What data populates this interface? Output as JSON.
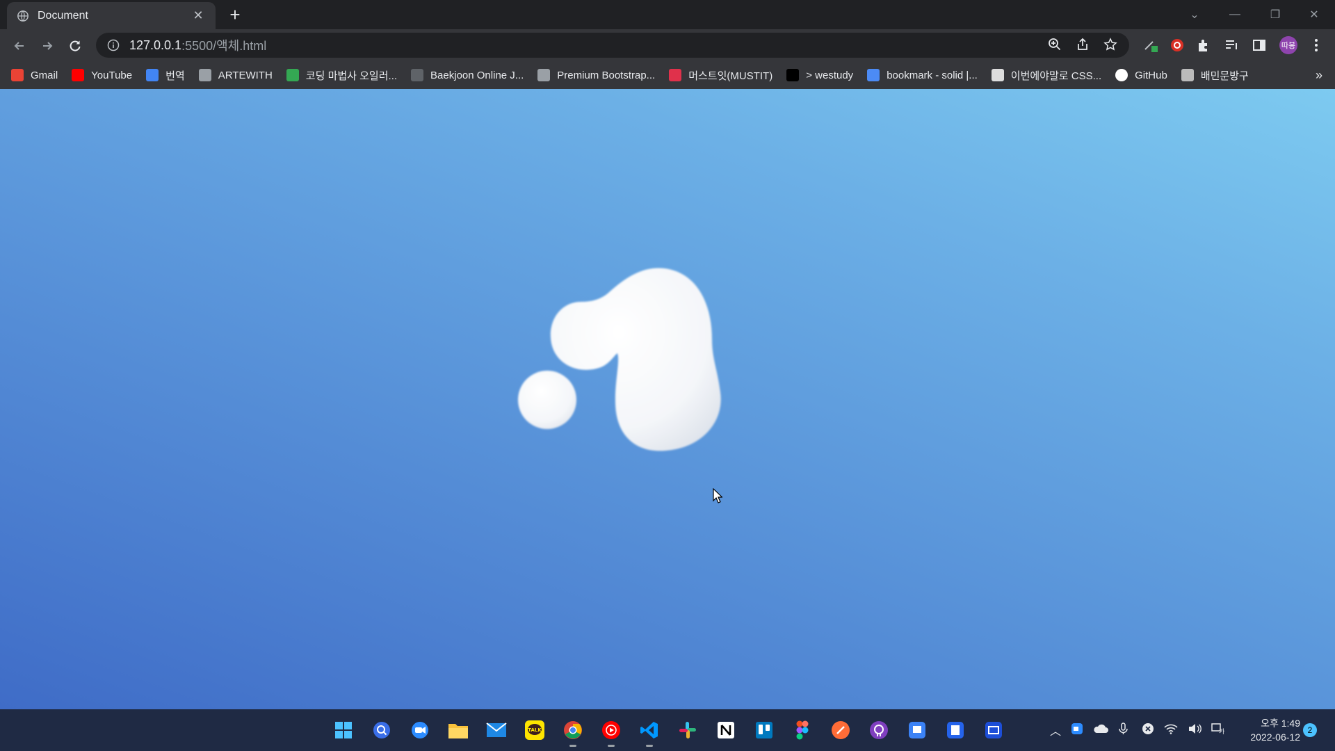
{
  "browser": {
    "tab": {
      "title": "Document",
      "close_icon": "close-icon",
      "favicon": "globe-icon"
    },
    "new_tab_label": "+",
    "address": {
      "host": "127.0.0.1",
      "path": ":5500/액체.html"
    },
    "profile_label": "따봉"
  },
  "bookmarks": [
    {
      "label": "Gmail",
      "icon": "gmail-icon",
      "color": "#ea4335"
    },
    {
      "label": "YouTube",
      "icon": "youtube-icon",
      "color": "#ff0000"
    },
    {
      "label": "번역",
      "icon": "translate-icon",
      "color": "#4285f4"
    },
    {
      "label": "ARTEWITH",
      "icon": "react-icon",
      "color": "#9aa0a6"
    },
    {
      "label": "코딩 마법사 오일러...",
      "icon": "chat-icon",
      "color": "#34a853"
    },
    {
      "label": "Baekjoon Online J...",
      "icon": "code-icon",
      "color": "#5f6368"
    },
    {
      "label": "Premium Bootstrap...",
      "icon": "layout-icon",
      "color": "#9aa0a6"
    },
    {
      "label": "머스트잇(MUSTIT)",
      "icon": "mustit-icon",
      "color": "#e0314b"
    },
    {
      "label": "> westudy",
      "icon": "westudy-icon",
      "color": "#000000"
    },
    {
      "label": "bookmark - solid |...",
      "icon": "flag-icon",
      "color": "#4c8bf5"
    },
    {
      "label": "이번에야말로 CSS...",
      "icon": "face-icon",
      "color": "#dddddd"
    },
    {
      "label": "GitHub",
      "icon": "github-icon",
      "color": "#ffffff"
    },
    {
      "label": "배민문방구",
      "icon": "baemin-icon",
      "color": "#bbbbbb"
    }
  ],
  "bookmarks_more": "»",
  "colors": {
    "bg_start": "#3f6cc7",
    "bg_end": "#7dcaf0",
    "blob": "#ffffff"
  },
  "taskbar": {
    "apps": [
      "windows-start-icon",
      "search-icon",
      "zoom-icon",
      "file-explorer-icon",
      "mail-icon",
      "kakaotalk-icon",
      "chrome-icon",
      "youtube-music-icon",
      "vscode-icon",
      "slack-icon",
      "notion-icon",
      "trello-icon",
      "figma-icon",
      "postman-icon",
      "github-desktop-icon",
      "app-icon-1",
      "app-icon-2",
      "app-icon-3"
    ],
    "kakaotalk_label": "TALK",
    "clock_time": "오후 1:49",
    "clock_date": "2022-06-12",
    "notification_count": "2"
  }
}
